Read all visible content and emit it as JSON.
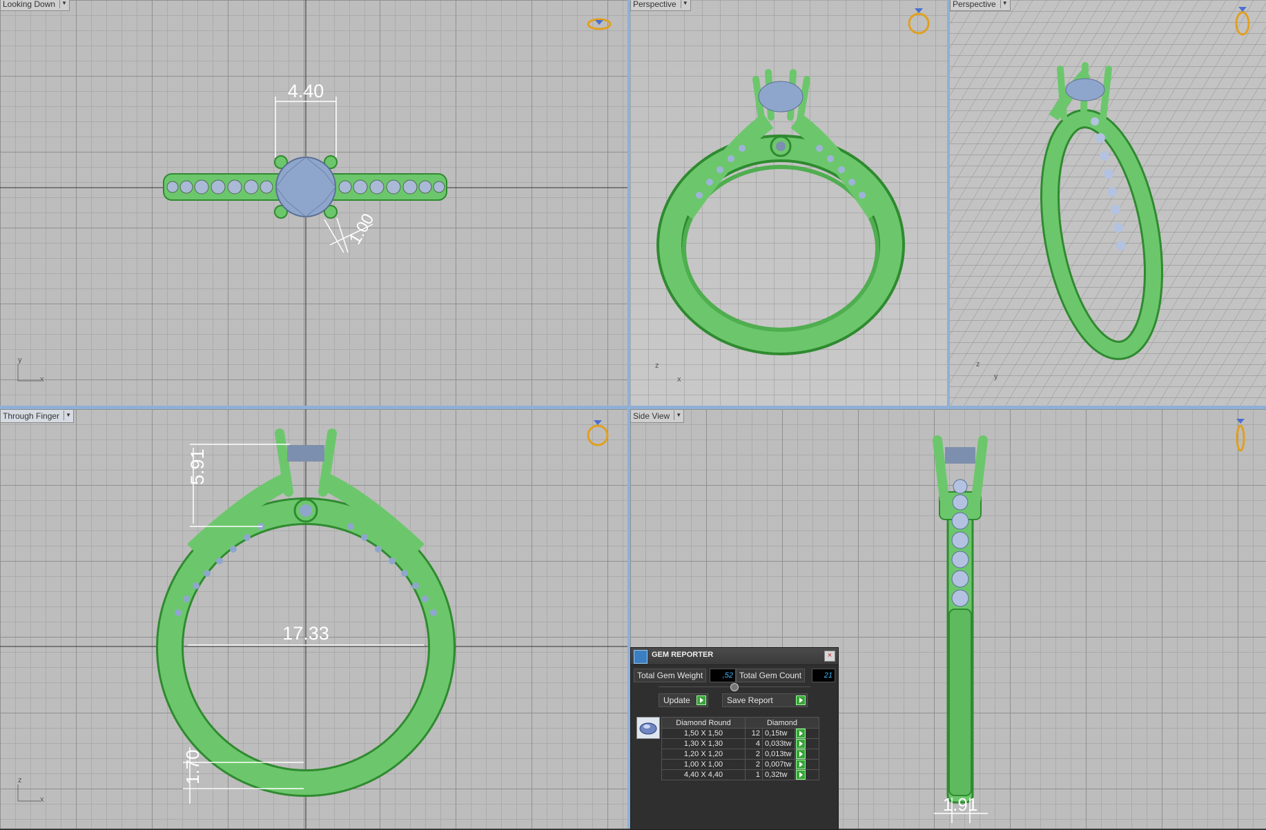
{
  "viewports": {
    "top_left": {
      "label": "Looking Down",
      "axis_v": "y",
      "axis_h": "x"
    },
    "top_mid": {
      "label": "Perspective",
      "axis_v": "z",
      "axis_h": "x"
    },
    "top_right": {
      "label": "Perspective",
      "axis_v": "z",
      "axis_h": "y"
    },
    "bottom_left": {
      "label": "Through Finger",
      "axis_v": "z",
      "axis_h": "x"
    },
    "bottom_right": {
      "label": "Side View"
    }
  },
  "dimensions": {
    "stone_width": "4.40",
    "prong_size": "1.00",
    "head_height": "5.91",
    "inner_diameter": "17.33",
    "band_thickness": "1.70",
    "band_width": "1.91"
  },
  "gem_reporter": {
    "title": "GEM REPORTER",
    "close": "×",
    "total_weight_label": "Total Gem Weight",
    "total_weight_value": ",52",
    "total_count_label": "Total Gem Count",
    "total_count_value": "21",
    "update_label": "Update",
    "save_label": "Save Report",
    "columns": [
      "Diamond Round",
      "Diamond"
    ],
    "rows": [
      {
        "size": "1,50 X 1,50",
        "count": "12",
        "weight": "0,15tw"
      },
      {
        "size": "1,30 X 1,30",
        "count": "4",
        "weight": "0,033tw"
      },
      {
        "size": "1,20 X 1,20",
        "count": "2",
        "weight": "0,013tw"
      },
      {
        "size": "1,00 X 1,00",
        "count": "2",
        "weight": "0,007tw"
      },
      {
        "size": "4,40 X 4,40",
        "count": "1",
        "weight": "0,32tw"
      }
    ]
  },
  "colors": {
    "metal": "#6cc76c",
    "metal_dark": "#2f8a2f",
    "stone": "#8fa6cc",
    "viewport_bg": "#bdbdbd",
    "divider": "#8fb0d6",
    "gizmo": "#e0a020"
  }
}
